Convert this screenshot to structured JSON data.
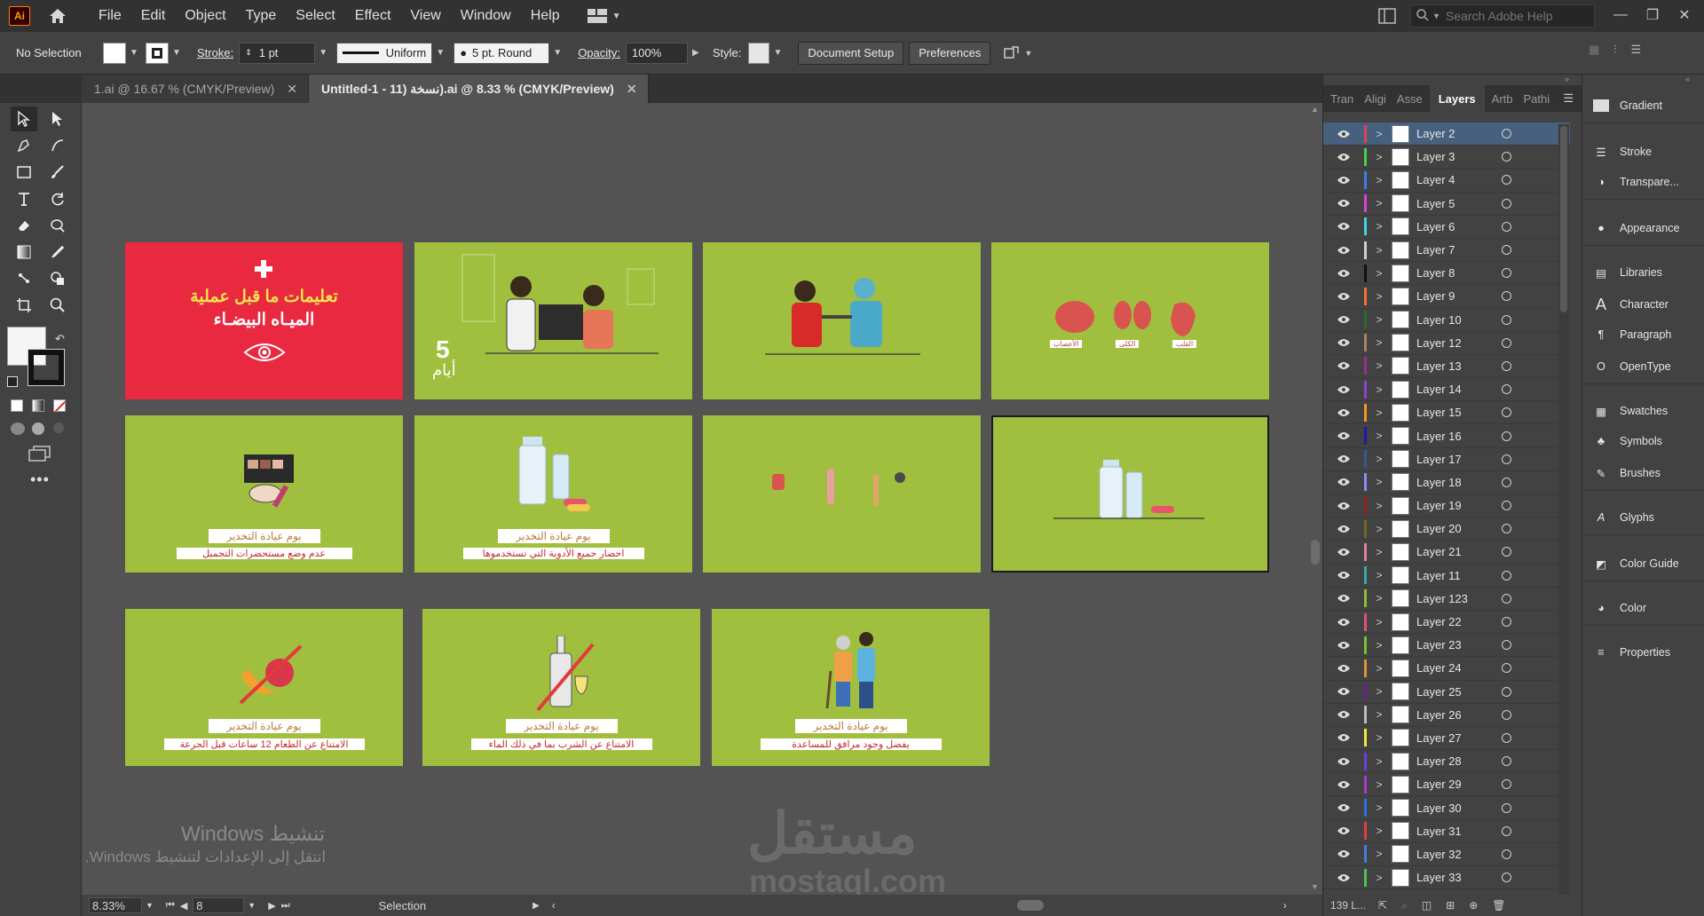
{
  "menubar": {
    "logo": "Ai",
    "items": [
      "File",
      "Edit",
      "Object",
      "Type",
      "Select",
      "Effect",
      "View",
      "Window",
      "Help"
    ],
    "search_placeholder": "Search Adobe Help"
  },
  "control": {
    "selection": "No Selection",
    "stroke_label": "Stroke:",
    "stroke_value": "1 pt",
    "stroke_profile": "Uniform",
    "brush": "5 pt. Round",
    "opacity_label": "Opacity:",
    "opacity_value": "100%",
    "style_label": "Style:",
    "document_setup": "Document Setup",
    "preferences": "Preferences"
  },
  "tabs": [
    {
      "label": "1.ai @ 16.67 % (CMYK/Preview)",
      "active": false
    },
    {
      "label": "Untitled-1 - 11) نسخة).ai @ 8.33 % (CMYK/Preview)",
      "active": true
    }
  ],
  "artboards": {
    "cover_line1": "تعليمات ما قبل عملية",
    "cover_line2": "الميـاه البيضـاء",
    "days_number": "5",
    "days_word": "أيام",
    "organ_labels": [
      "الأعصاب",
      "الكلى",
      "القلب"
    ],
    "caption_title": "يوم عيادة التخدير",
    "captions": [
      "عدم وضع مستحضرات التجميل",
      "احضار جميع الأدوية التي تستخدموها",
      "الامتناع عن الطعام 12 ساعات قبل الجرعة",
      "الامتناع عن الشرب بما في ذلك الماء",
      "يفضل وجود مرافق للمساعدة"
    ]
  },
  "watermark": {
    "windows_line1": "تنشيط Windows",
    "windows_line2": "انتقل إلى الإعدادات لتنشيط Windows.",
    "logo_arabic": "مستقل",
    "logo_latin": "mostaql.com"
  },
  "status": {
    "zoom": "8.33%",
    "artboard_num": "8",
    "tool": "Selection"
  },
  "layers_panel": {
    "tabs": [
      "Tran",
      "Aligi",
      "Asse",
      "Layers",
      "Artb",
      "Pathi"
    ],
    "layers": [
      {
        "name": "Layer 2",
        "color": "#e1434f",
        "selected": true
      },
      {
        "name": "Layer 3",
        "color": "#3fd64a"
      },
      {
        "name": "Layer 4",
        "color": "#3a7df0"
      },
      {
        "name": "Layer 5",
        "color": "#e23fd5"
      },
      {
        "name": "Layer 6",
        "color": "#3fd7e4"
      },
      {
        "name": "Layer 7",
        "color": "#cfcfcf"
      },
      {
        "name": "Layer 8",
        "color": "#111111"
      },
      {
        "name": "Layer 9",
        "color": "#f0742d"
      },
      {
        "name": "Layer 10",
        "color": "#2c6a2f"
      },
      {
        "name": "Layer 12",
        "color": "#b08057"
      },
      {
        "name": "Layer 13",
        "color": "#9a2f8c"
      },
      {
        "name": "Layer 14",
        "color": "#8f3fe0"
      },
      {
        "name": "Layer 15",
        "color": "#f29a21"
      },
      {
        "name": "Layer 16",
        "color": "#1c1ca8"
      },
      {
        "name": "Layer 17",
        "color": "#2f5c8f"
      },
      {
        "name": "Layer 18",
        "color": "#8b8ef0"
      },
      {
        "name": "Layer 19",
        "color": "#9c1b1b"
      },
      {
        "name": "Layer 20",
        "color": "#6f6a1f"
      },
      {
        "name": "Layer 21",
        "color": "#e17f9e"
      },
      {
        "name": "Layer 11",
        "color": "#3aa7a4"
      },
      {
        "name": "Layer 123",
        "color": "#8fbf2e"
      },
      {
        "name": "Layer 22",
        "color": "#e0527a"
      },
      {
        "name": "Layer 23",
        "color": "#7fbf2f"
      },
      {
        "name": "Layer 24",
        "color": "#e3932f"
      },
      {
        "name": "Layer 25",
        "color": "#6e1f8f"
      },
      {
        "name": "Layer 26",
        "color": "#bdbdbd"
      },
      {
        "name": "Layer 27",
        "color": "#f2ea3a"
      },
      {
        "name": "Layer 28",
        "color": "#6a3fe0"
      },
      {
        "name": "Layer 29",
        "color": "#9e3fd6"
      },
      {
        "name": "Layer 30",
        "color": "#2f6fe0"
      },
      {
        "name": "Layer 31",
        "color": "#e14040"
      },
      {
        "name": "Layer 32",
        "color": "#3f7fe0"
      },
      {
        "name": "Layer 33",
        "color": "#4fc24f"
      }
    ],
    "count": "139 L..."
  },
  "dock": [
    "Gradient",
    "Stroke",
    "Transpare...",
    "Appearance",
    "Libraries",
    "Character",
    "Paragraph",
    "OpenType",
    "Swatches",
    "Symbols",
    "Brushes",
    "Glyphs",
    "Color Guide",
    "Color",
    "Properties"
  ]
}
